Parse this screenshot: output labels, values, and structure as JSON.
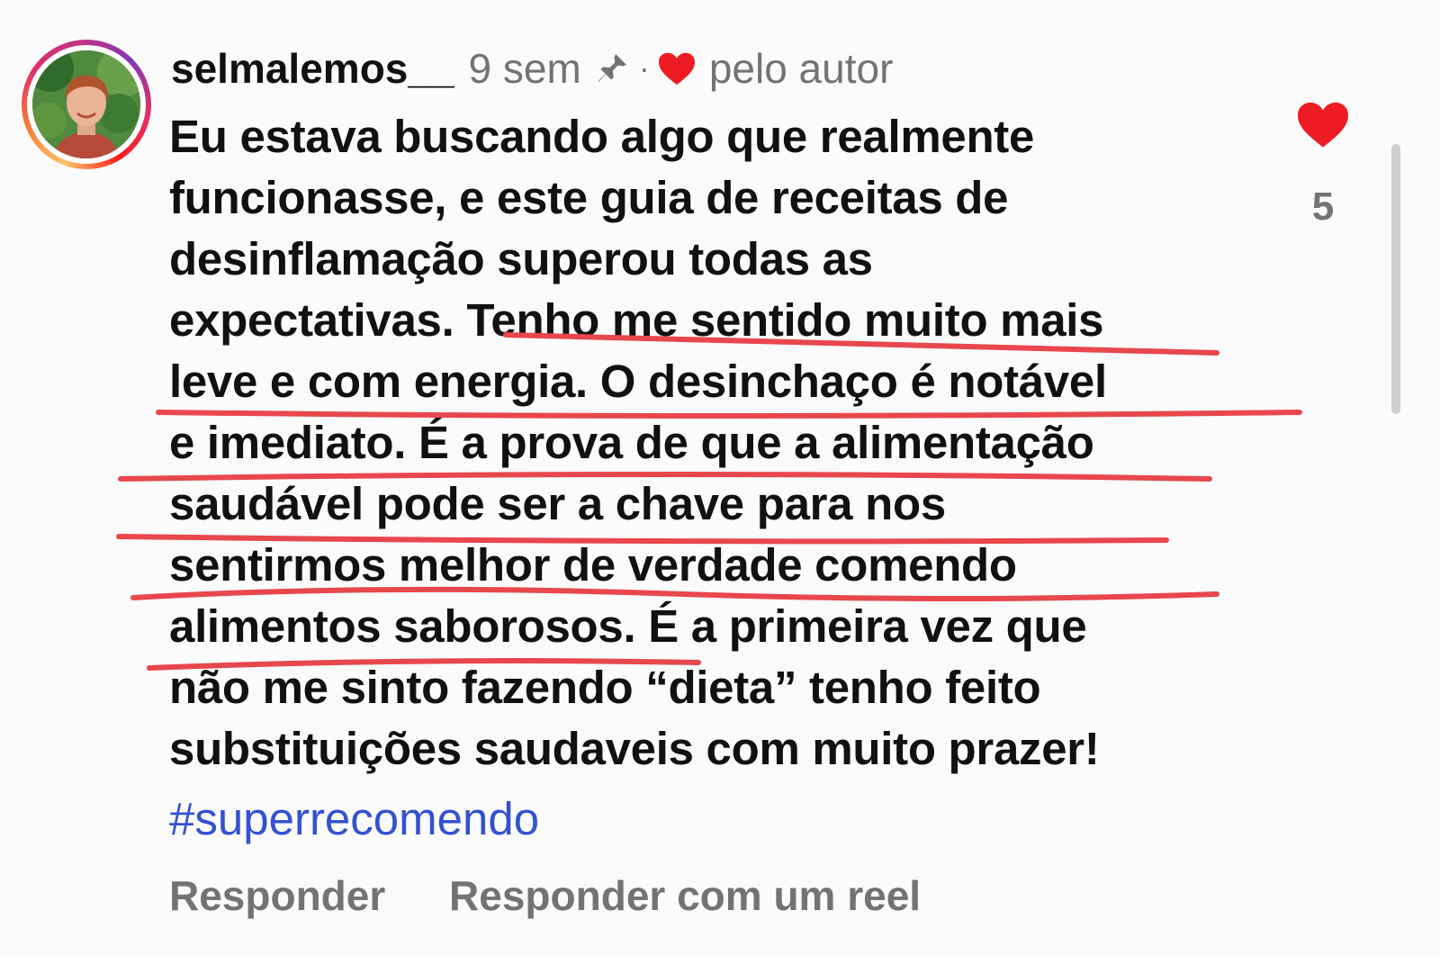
{
  "comment": {
    "username": "selmalemos__",
    "time": "9 sem",
    "separator": "·",
    "liked_by": "pelo autor",
    "lines": [
      "Eu estava buscando algo que realmente",
      "funcionasse, e este guia de receitas de",
      "desinflamação superou todas as",
      "expectativas. Tenho me sentido muito mais",
      "leve e com energia. O desinchaço é notável",
      "e imediato. É a prova de que a alimentação",
      "saudável pode ser a chave para nos",
      "sentirmos melhor de verdade comendo",
      "alimentos saborosos. É a primeira vez que",
      "não me sinto fazendo “dieta” tenho feito",
      "substituições saudaveis com muito prazer!"
    ],
    "hashtag": "#superrecomendo",
    "reply_label": "Responder",
    "reply_reel_label": "Responder com um reel",
    "like_count": "5"
  },
  "icons": {
    "pin": "pin-icon",
    "heart_small": "heart-icon",
    "like": "heart-icon"
  },
  "colors": {
    "heart": "#ed1c24",
    "hashtag": "#3451d1",
    "muted": "#737373",
    "underline": "#e8474c"
  }
}
